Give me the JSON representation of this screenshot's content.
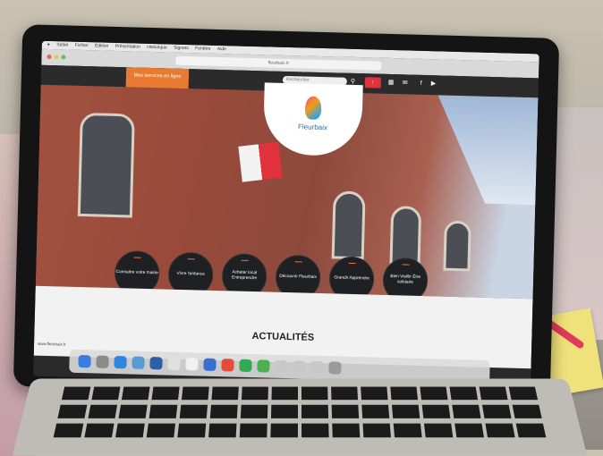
{
  "menubar": {
    "items": [
      "Safari",
      "Fichier",
      "Édition",
      "Présentation",
      "Historique",
      "Signets",
      "Fenêtre",
      "Aide"
    ]
  },
  "browser": {
    "url": "fleurbaix.fr"
  },
  "site": {
    "quick_button": "Mes services en ligne",
    "search_placeholder": "Rechercher",
    "logo_text": "Fleurbaix",
    "circles": [
      "Connaitre votre mairie",
      "Vivre l'enfance",
      "Acheter local Entreprendre",
      "Découvrir Fleurbaix",
      "Grandir Apprendre",
      "Bien Vieillir Être solidaire"
    ],
    "section_title": "ACTUALITÉS",
    "status_text": "www.fleurbaix.fr"
  },
  "colors": {
    "accent_orange": "#e97a32",
    "circle_dark": "#1f2023",
    "flag_red": "#e0313c",
    "brick": "#9a4a3a"
  }
}
